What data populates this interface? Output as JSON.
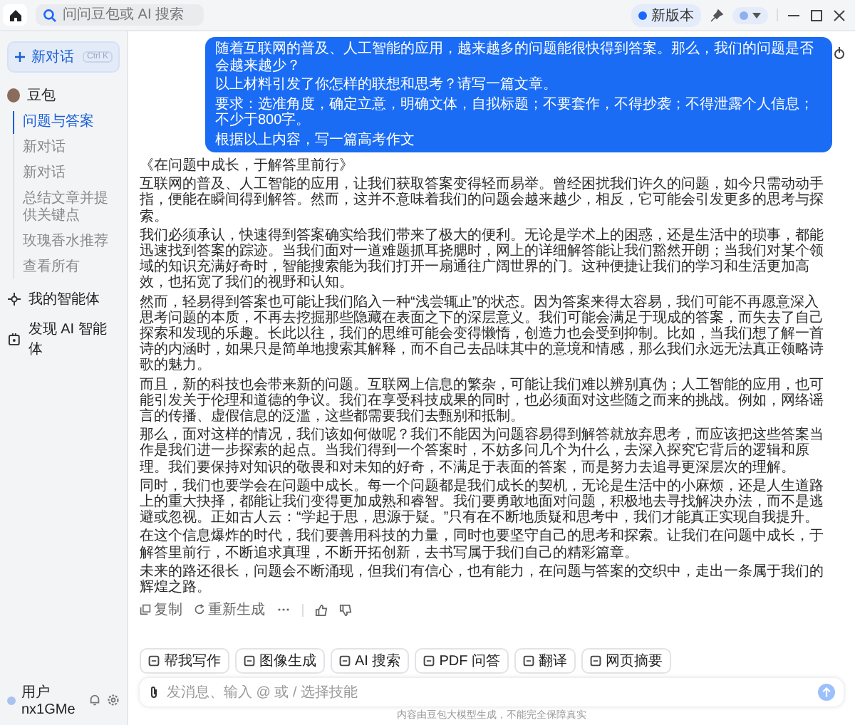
{
  "topbar": {
    "search": {
      "placeholder": "问问豆包或 AI 搜索"
    },
    "update_badge": "新版本"
  },
  "sidebar": {
    "new_chat": {
      "label": "新对话",
      "shortcut": "Ctrl K"
    },
    "bot": {
      "name": "豆包"
    },
    "conversations": [
      {
        "title": "问题与答案",
        "selected": true
      },
      {
        "title": "新对话",
        "selected": false
      },
      {
        "title": "新对话",
        "selected": false
      },
      {
        "title": "总结文章并提供关键点",
        "selected": false
      },
      {
        "title": "玫瑰香水推荐",
        "selected": false
      }
    ],
    "view_all": "查看所有",
    "nav": [
      "我的智能体",
      "发现 AI 智能体"
    ],
    "user": {
      "name": "用户nx1GMe"
    }
  },
  "chat": {
    "user_message": [
      "随着互联网的普及、人工智能的应用，越来越多的问题能很快得到答案。那么，我们的问题是否会越来越少？",
      "以上材料引发了你怎样的联想和思考？请写一篇文章。",
      "要求：选准角度，确定立意，明确文体，自拟标题；不要套作，不得抄袭；不得泄露个人信息；不少于800字。",
      "根据以上内容，写一篇高考作文"
    ],
    "answer": {
      "title": "《在问题中成长，于解答里前行》",
      "paragraphs": [
        "互联网的普及、人工智能的应用，让我们获取答案变得轻而易举。曾经困扰我们许久的问题，如今只需动动手指，便能在瞬间得到解答。然而，这并不意味着我们的问题会越来越少，相反，它可能会引发更多的思考与探索。",
        "我们必须承认，快速得到答案确实给我们带来了极大的便利。无论是学术上的困惑，还是生活中的琐事，都能迅速找到答案的踪迹。当我们面对一道难题抓耳挠腮时，网上的详细解答能让我们豁然开朗；当我们对某个领域的知识充满好奇时，智能搜索能为我们打开一扇通往广阔世界的门。这种便捷让我们的学习和生活更加高效，也拓宽了我们的视野和认知。",
        "然而，轻易得到答案也可能让我们陷入一种“浅尝辄止”的状态。因为答案来得太容易，我们可能不再愿意深入思考问题的本质，不再去挖掘那些隐藏在表面之下的深层意义。我们可能会满足于现成的答案，而失去了自己探索和发现的乐趣。长此以往，我们的思维可能会变得懒惰，创造力也会受到抑制。比如，当我们想了解一首诗的内涵时，如果只是简单地搜索其解释，而不自己去品味其中的意境和情感，那么我们永远无法真正领略诗歌的魅力。",
        "而且，新的科技也会带来新的问题。互联网上信息的繁杂，可能让我们难以辨别真伪；人工智能的应用，也可能引发关于伦理和道德的争议。我们在享受科技成果的同时，也必须面对这些随之而来的挑战。例如，网络谣言的传播、虚假信息的泛滥，这些都需要我们去甄别和抵制。",
        "那么，面对这样的情况，我们该如何做呢？我们不能因为问题容易得到解答就放弃思考，而应该把这些答案当作是我们进一步探索的起点。当我们得到一个答案时，不妨多问几个为什么，去深入探究它背后的逻辑和原理。我们要保持对知识的敬畏和对未知的好奇，不满足于表面的答案，而是努力去追寻更深层次的理解。",
        "同时，我们也要学会在问题中成长。每一个问题都是我们成长的契机，无论是生活中的小麻烦，还是人生道路上的重大抉择，都能让我们变得更加成熟和睿智。我们要勇敢地面对问题，积极地去寻找解决办法，而不是逃避或忽视。正如古人云：“学起于思，思源于疑。”只有在不断地质疑和思考中，我们才能真正实现自我提升。",
        "在这个信息爆炸的时代，我们要善用科技的力量，同时也要坚守自己的思考和探索。让我们在问题中成长，于解答里前行，不断追求真理，不断开拓创新，去书写属于我们自己的精彩篇章。",
        "未来的路还很长，问题会不断涌现，但我们有信心，也有能力，在问题与答案的交织中，走出一条属于我们的辉煌之路。"
      ]
    },
    "actions": [
      "复制",
      "重新生成"
    ],
    "suggestions": [
      "帮我写作",
      "图像生成",
      "AI 搜索",
      "PDF 问答",
      "翻译",
      "网页摘要"
    ],
    "input": {
      "placeholder": "发消息、输入 @ 或 / 选择技能"
    },
    "disclaimer": "内容由豆包大模型生成，不能完全保障真实"
  }
}
